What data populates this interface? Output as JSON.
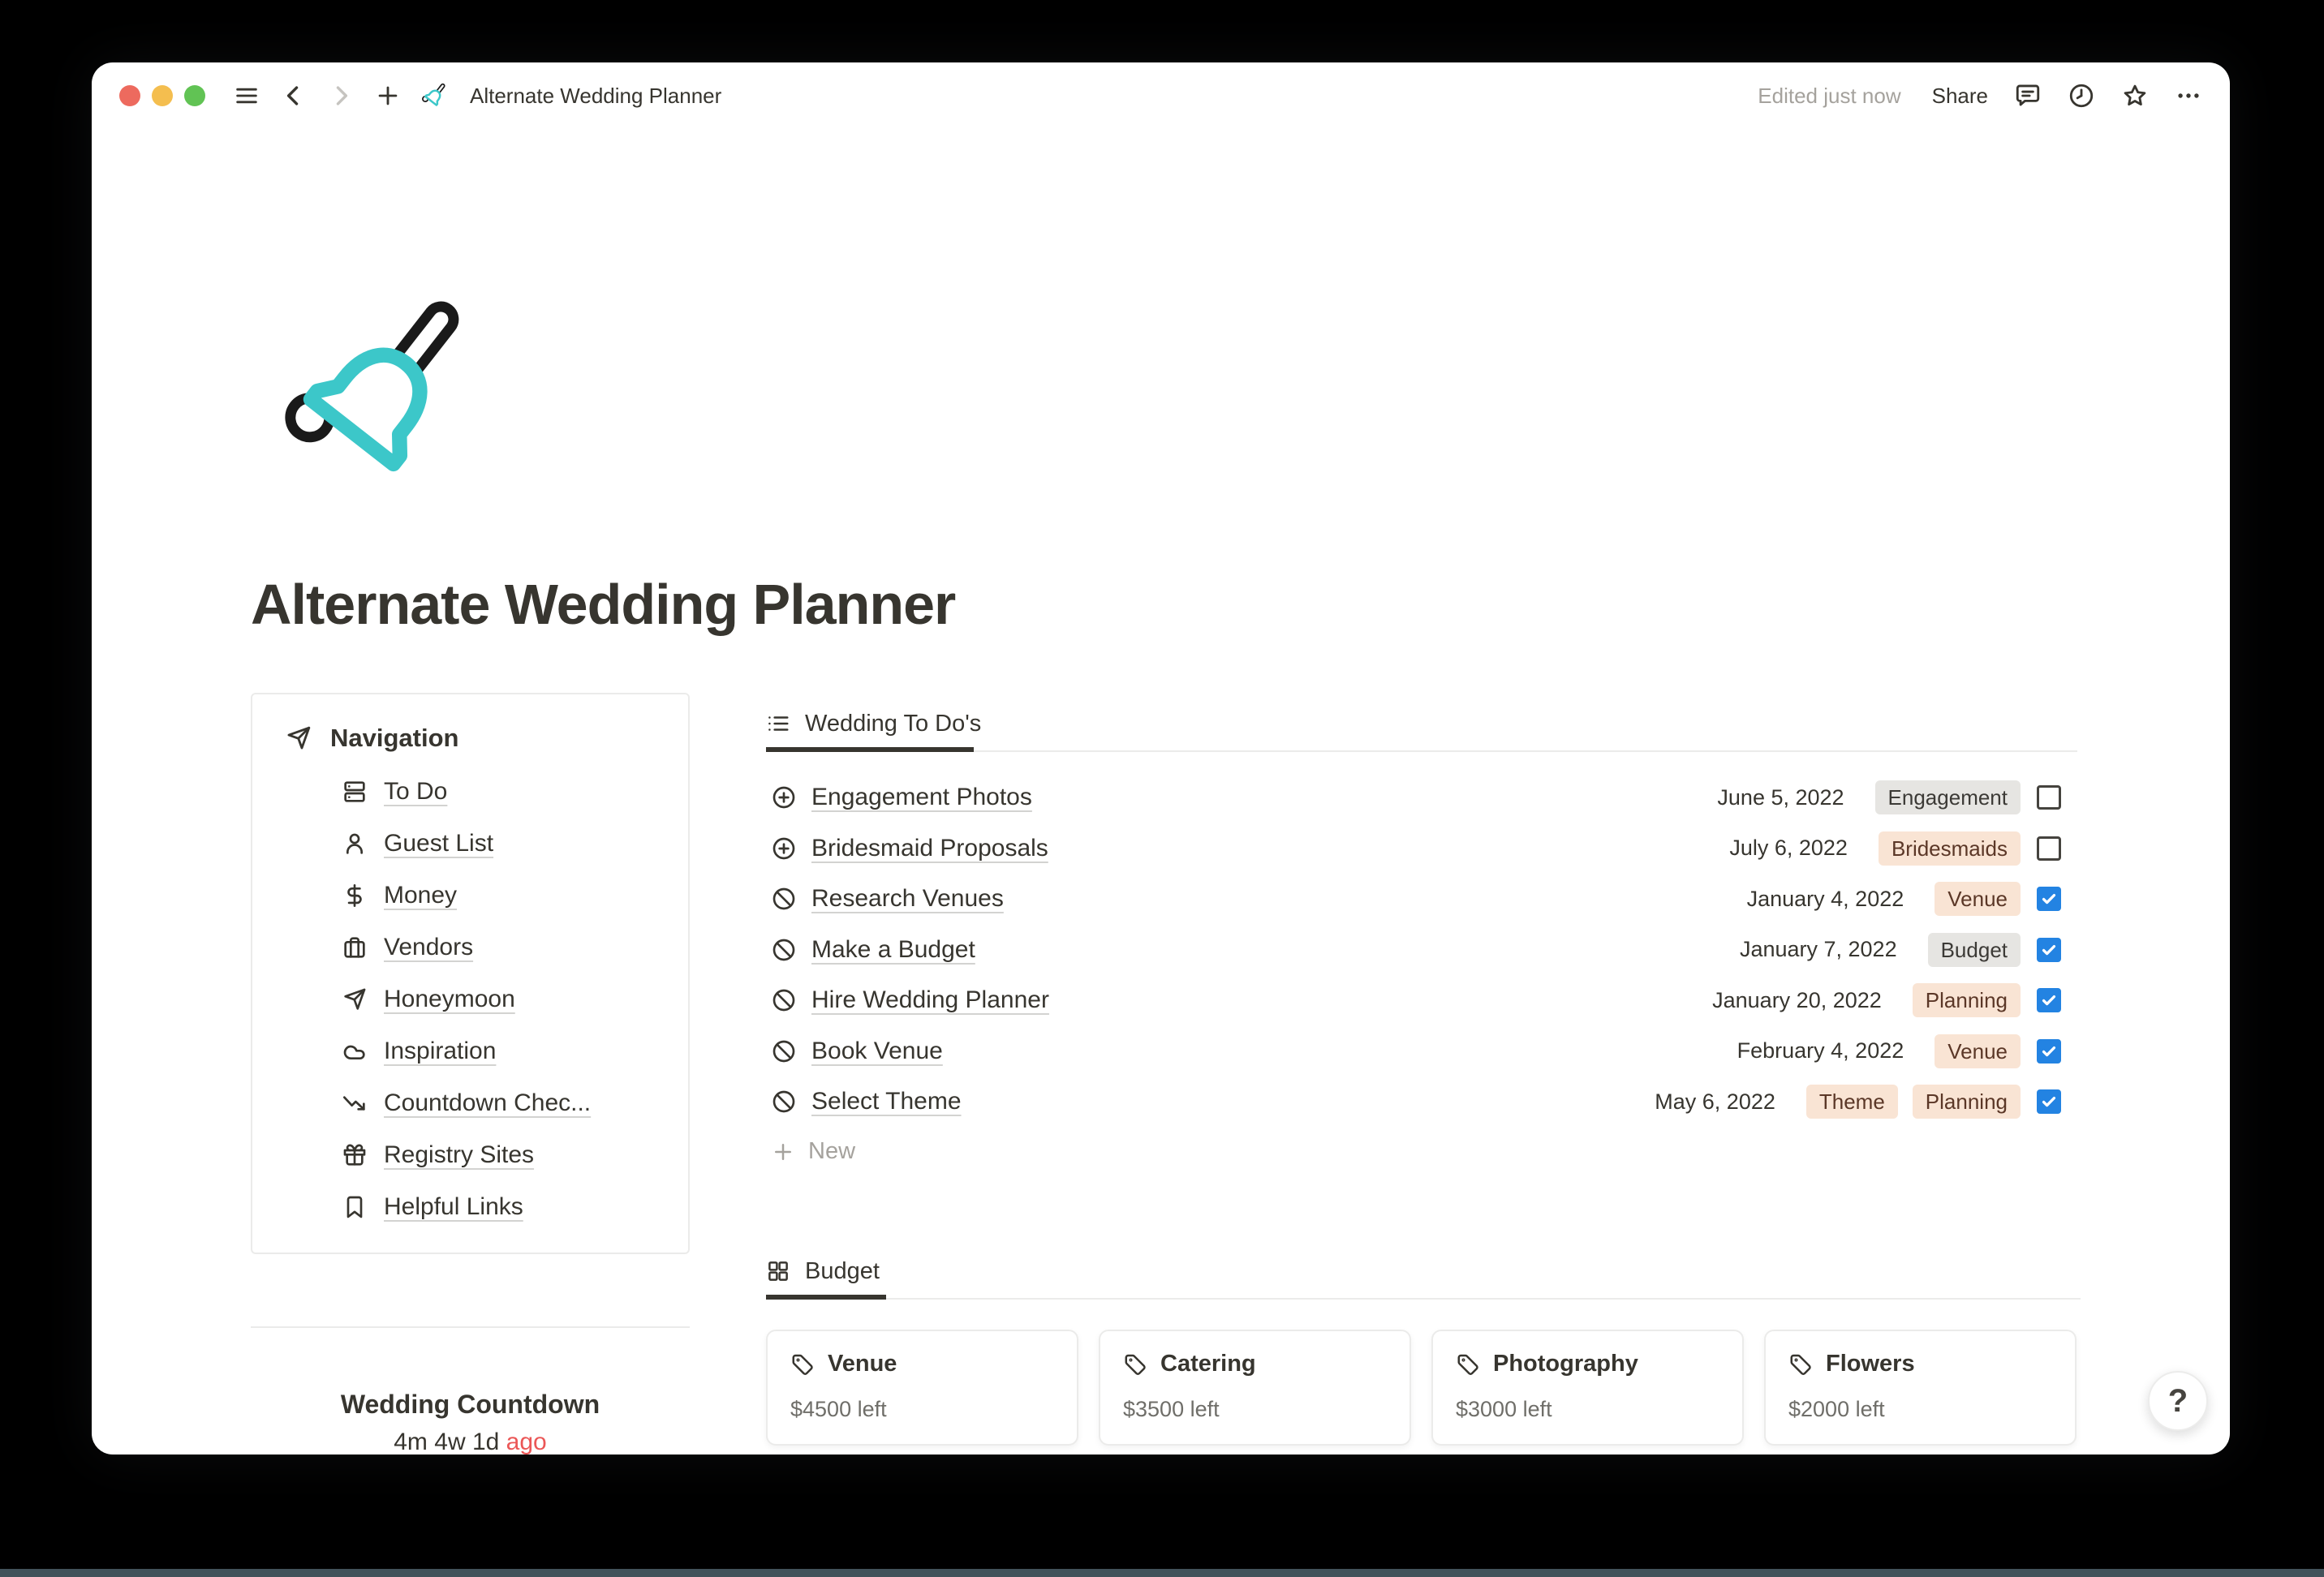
{
  "topbar": {
    "title": "Alternate Wedding Planner",
    "edited": "Edited just now",
    "share_label": "Share"
  },
  "page": {
    "title": "Alternate Wedding Planner"
  },
  "navigation": {
    "header": "Navigation",
    "items": [
      {
        "label": "To Do",
        "icon": "database"
      },
      {
        "label": "Guest List",
        "icon": "person"
      },
      {
        "label": "Money",
        "icon": "dollar"
      },
      {
        "label": "Vendors",
        "icon": "briefcase"
      },
      {
        "label": "Honeymoon",
        "icon": "paper-plane"
      },
      {
        "label": "Inspiration",
        "icon": "cloud"
      },
      {
        "label": "Countdown Chec...",
        "icon": "trending-down"
      },
      {
        "label": "Registry Sites",
        "icon": "gift"
      },
      {
        "label": "Helpful Links",
        "icon": "bookmark"
      }
    ]
  },
  "todo": {
    "tab_label": "Wedding To Do's",
    "new_label": "New",
    "rows": [
      {
        "icon": "plus-circle",
        "name": "Engagement Photos",
        "date": "June 5, 2022",
        "tags": [
          {
            "label": "Engagement",
            "color": "gray"
          }
        ],
        "checked": false
      },
      {
        "icon": "plus-circle",
        "name": "Bridesmaid Proposals",
        "date": "July 6, 2022",
        "tags": [
          {
            "label": "Bridesmaids",
            "color": "peach"
          }
        ],
        "checked": false
      },
      {
        "icon": "slash-circle",
        "name": "Research Venues",
        "date": "January 4, 2022",
        "tags": [
          {
            "label": "Venue",
            "color": "peach"
          }
        ],
        "checked": true
      },
      {
        "icon": "slash-circle",
        "name": "Make a Budget",
        "date": "January 7, 2022",
        "tags": [
          {
            "label": "Budget",
            "color": "gray"
          }
        ],
        "checked": true
      },
      {
        "icon": "slash-circle",
        "name": "Hire Wedding Planner",
        "date": "January 20, 2022",
        "tags": [
          {
            "label": "Planning",
            "color": "peach"
          }
        ],
        "checked": true
      },
      {
        "icon": "slash-circle",
        "name": "Book Venue",
        "date": "February 4, 2022",
        "tags": [
          {
            "label": "Venue",
            "color": "peach"
          }
        ],
        "checked": true
      },
      {
        "icon": "slash-circle",
        "name": "Select Theme",
        "date": "May 6, 2022",
        "tags": [
          {
            "label": "Theme",
            "color": "peach"
          },
          {
            "label": "Planning",
            "color": "peach"
          }
        ],
        "checked": true
      }
    ]
  },
  "budget": {
    "tab_label": "Budget",
    "cards": [
      {
        "title": "Venue",
        "amount": "$4500 left"
      },
      {
        "title": "Catering",
        "amount": "$3500 left"
      },
      {
        "title": "Photography",
        "amount": "$3000 left"
      },
      {
        "title": "Flowers",
        "amount": "$2000 left"
      }
    ]
  },
  "countdown": {
    "title": "Wedding Countdown",
    "value": "4m 4w 1d",
    "suffix": "ago"
  },
  "help_label": "?",
  "colors": {
    "accent_teal": "#3cc7c9",
    "checkbox_blue": "#2383e2",
    "ago_red": "#eb5757",
    "tag_gray_bg": "#e6e5e2",
    "tag_peach_bg": "#f9e4d4",
    "traffic_red": "#ed6a5e",
    "traffic_yellow": "#f4be4f",
    "traffic_green": "#61c354"
  }
}
